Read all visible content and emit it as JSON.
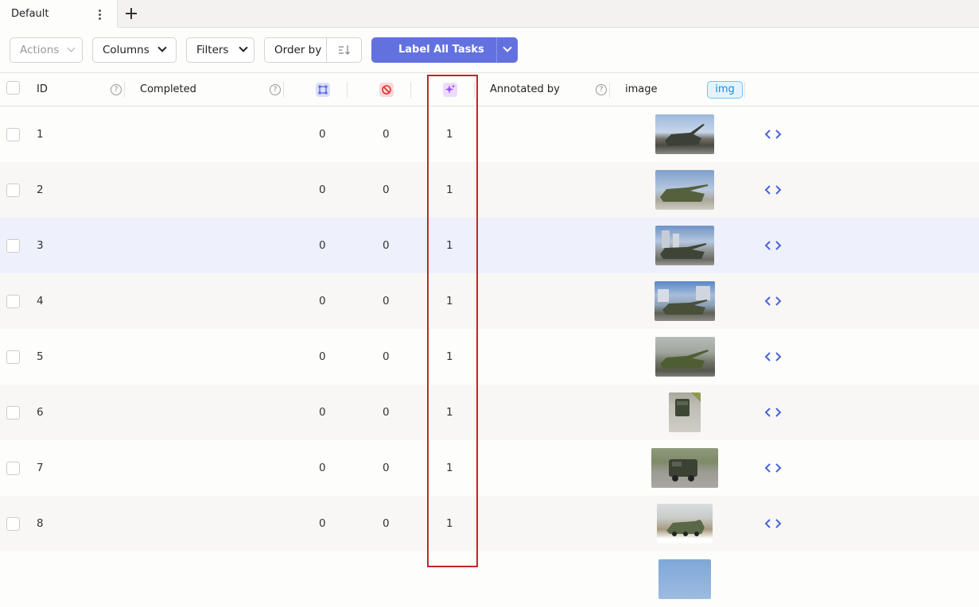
{
  "tabs": [
    {
      "label": "Default",
      "active": true
    }
  ],
  "toolbar": {
    "actions": "Actions",
    "columns": "Columns",
    "filters": "Filters",
    "order_by": "Order by",
    "label_all": "Label All Tasks"
  },
  "columns": {
    "id": "ID",
    "completed": "Completed",
    "annotations_icon": "annotations-icon",
    "cancelled_icon": "cancelled-icon",
    "predictions_icon": "predictions-icon",
    "annotated_by": "Annotated by",
    "image": "image",
    "image_badge": "img"
  },
  "rows": [
    {
      "id": "1",
      "annotations": "0",
      "cancelled": "0",
      "predictions": "1"
    },
    {
      "id": "2",
      "annotations": "0",
      "cancelled": "0",
      "predictions": "1"
    },
    {
      "id": "3",
      "annotations": "0",
      "cancelled": "0",
      "predictions": "1"
    },
    {
      "id": "4",
      "annotations": "0",
      "cancelled": "0",
      "predictions": "1"
    },
    {
      "id": "5",
      "annotations": "0",
      "cancelled": "0",
      "predictions": "1"
    },
    {
      "id": "6",
      "annotations": "0",
      "cancelled": "0",
      "predictions": "1"
    },
    {
      "id": "7",
      "annotations": "0",
      "cancelled": "0",
      "predictions": "1"
    },
    {
      "id": "8",
      "annotations": "0",
      "cancelled": "0",
      "predictions": "1"
    }
  ],
  "colors": {
    "accent": "#6371df",
    "highlight": "#c0262d",
    "selected_row": "#eef0fc",
    "code_icon": "#4a63d8"
  }
}
